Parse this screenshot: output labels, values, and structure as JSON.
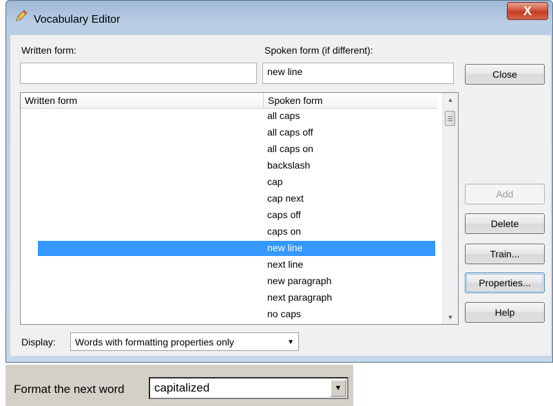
{
  "window": {
    "title": "Vocabulary Editor",
    "close_glyph": "X",
    "icon": "pencil-icon"
  },
  "labels": {
    "written_form": "Written form:",
    "spoken_form": "Spoken form (if different):",
    "display": "Display:"
  },
  "inputs": {
    "written_value": "",
    "spoken_value": "new line"
  },
  "list": {
    "col_written": "Written form",
    "col_spoken": "Spoken form",
    "rows": [
      {
        "spoken": "all caps"
      },
      {
        "spoken": "all caps off"
      },
      {
        "spoken": "all caps on"
      },
      {
        "spoken": "backslash"
      },
      {
        "spoken": "cap"
      },
      {
        "spoken": "cap next"
      },
      {
        "spoken": "caps off"
      },
      {
        "spoken": "caps on"
      },
      {
        "spoken": "new line"
      },
      {
        "spoken": "next line"
      },
      {
        "spoken": "new paragraph"
      },
      {
        "spoken": "next paragraph"
      },
      {
        "spoken": "no caps"
      }
    ],
    "selected_index": 8
  },
  "buttons": {
    "close": "Close",
    "add": "Add",
    "delete": "Delete",
    "train": "Train...",
    "properties": "Properties...",
    "help": "Help"
  },
  "display_select": {
    "value": "Words with formatting properties only"
  },
  "lower": {
    "label": "Format the next word",
    "combo_value": "capitalized"
  },
  "colors": {
    "selection": "#3399ff",
    "titlebar": "#b9cde4",
    "close_button": "#c43b22"
  }
}
